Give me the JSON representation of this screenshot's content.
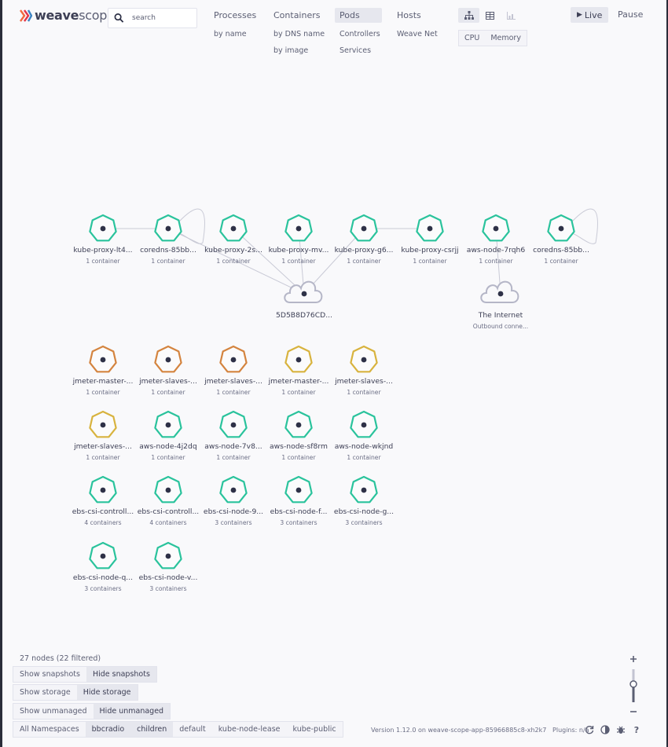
{
  "brand": {
    "name_a": "weave",
    "name_b": "scope"
  },
  "search": {
    "placeholder": "search"
  },
  "topnav": {
    "processes": "Processes",
    "processes_by_name": "by name",
    "containers": "Containers",
    "containers_by_dns": "by DNS name",
    "containers_by_image": "by image",
    "pods": "Pods",
    "controllers": "Controllers",
    "services": "Services",
    "hosts": "Hosts",
    "weave_net": "Weave Net"
  },
  "view_modes": {
    "graph_icon": "graph-view-icon",
    "table_icon": "table-view-icon",
    "resources_icon": "resources-view-icon",
    "active": "graph"
  },
  "metrics": {
    "cpu": "CPU",
    "memory": "Memory"
  },
  "controls": {
    "live": "Live",
    "pause": "Pause"
  },
  "colors": {
    "green": "#2ac39c",
    "orange": "#d4843f",
    "yellow": "#d8b33e",
    "cloud": "#b5b6c7",
    "dot": "#2e3147"
  },
  "nodes": [
    {
      "label": "kube-proxy-lt4...",
      "sub": "1 container",
      "color": "green"
    },
    {
      "label": "coredns-85bb...",
      "sub": "1 container",
      "color": "green",
      "self_loop": true
    },
    {
      "label": "kube-proxy-2s...",
      "sub": "1 container",
      "color": "green"
    },
    {
      "label": "kube-proxy-mv...",
      "sub": "1 container",
      "color": "green"
    },
    {
      "label": "kube-proxy-g6...",
      "sub": "1 container",
      "color": "green"
    },
    {
      "label": "kube-proxy-csrjj",
      "sub": "1 container",
      "color": "green"
    },
    {
      "label": "aws-node-7rqh6",
      "sub": "1 container",
      "color": "green"
    },
    {
      "label": "coredns-85bb...",
      "sub": "1 container",
      "color": "green",
      "self_loop": true
    },
    {
      "label": "5D5B8D76CD...",
      "sub": "",
      "shape": "cloud"
    },
    {
      "label": "The Internet",
      "sub": "Outbound conne...",
      "shape": "cloud"
    },
    {
      "label": "jmeter-master-...",
      "sub": "1 container",
      "color": "orange"
    },
    {
      "label": "jmeter-slaves-...",
      "sub": "1 container",
      "color": "orange"
    },
    {
      "label": "jmeter-slaves-...",
      "sub": "1 container",
      "color": "orange"
    },
    {
      "label": "jmeter-master-...",
      "sub": "1 container",
      "color": "yellow"
    },
    {
      "label": "jmeter-slaves-...",
      "sub": "1 container",
      "color": "yellow"
    },
    {
      "label": "jmeter-slaves-...",
      "sub": "1 container",
      "color": "yellow"
    },
    {
      "label": "aws-node-4j2dq",
      "sub": "1 container",
      "color": "green"
    },
    {
      "label": "aws-node-7v8...",
      "sub": "1 container",
      "color": "green"
    },
    {
      "label": "aws-node-sf8rm",
      "sub": "1 container",
      "color": "green"
    },
    {
      "label": "aws-node-wkjnd",
      "sub": "1 container",
      "color": "green"
    },
    {
      "label": "ebs-csi-controll...",
      "sub": "4 containers",
      "color": "green"
    },
    {
      "label": "ebs-csi-controll...",
      "sub": "4 containers",
      "color": "green"
    },
    {
      "label": "ebs-csi-node-9...",
      "sub": "3 containers",
      "color": "green"
    },
    {
      "label": "ebs-csi-node-f...",
      "sub": "3 containers",
      "color": "green"
    },
    {
      "label": "ebs-csi-node-g...",
      "sub": "3 containers",
      "color": "green"
    },
    {
      "label": "ebs-csi-node-q...",
      "sub": "3 containers",
      "color": "green"
    },
    {
      "label": "ebs-csi-node-v...",
      "sub": "3 containers",
      "color": "green"
    }
  ],
  "edges": [
    [
      0,
      1
    ],
    [
      1,
      8
    ],
    [
      2,
      8
    ],
    [
      3,
      8
    ],
    [
      4,
      8
    ],
    [
      5,
      4
    ],
    [
      6,
      9
    ]
  ],
  "status": {
    "node_count": "27 nodes (22 filtered)"
  },
  "toggles": {
    "show_snapshots": "Show snapshots",
    "hide_snapshots": "Hide snapshots",
    "show_storage": "Show storage",
    "hide_storage": "Hide storage",
    "show_unmanaged": "Show unmanaged",
    "hide_unmanaged": "Hide unmanaged"
  },
  "namespaces": [
    "All Namespaces",
    "bbcradio",
    "children",
    "default",
    "kube-node-lease",
    "kube-public"
  ],
  "namespaces_active": [
    "bbcradio",
    "children"
  ],
  "footer": {
    "version": "Version 1.12.0 on weave-scope-app-85966885c8-xh2k7",
    "plugins": "Plugins: n/a"
  },
  "footer_icons": [
    "refresh-icon",
    "contrast-icon",
    "bug-icon",
    "help-icon"
  ],
  "zoom": {
    "plus": "+",
    "minus": "−",
    "level": 0.55
  }
}
